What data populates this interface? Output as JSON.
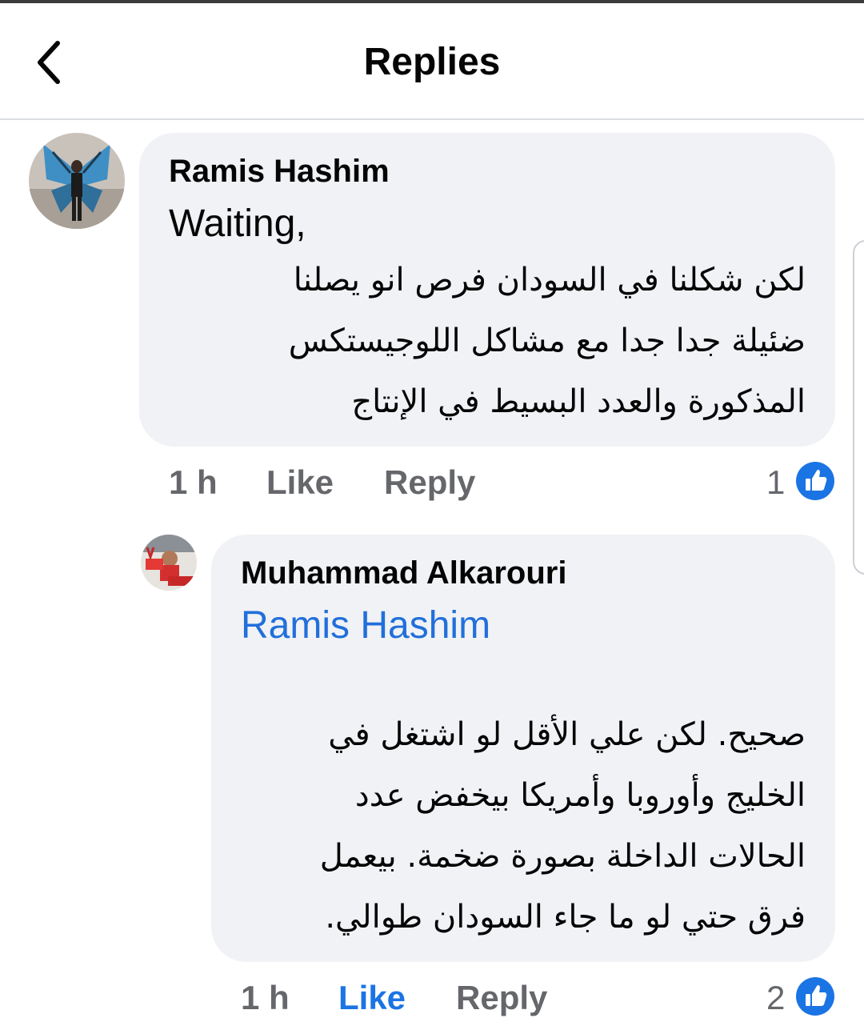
{
  "header": {
    "title": "Replies",
    "back_icon": "chevron-left-icon"
  },
  "comments": [
    {
      "author": "Ramis Hashim",
      "text_en": "Waiting,",
      "text_ar_lines": [
        "لكن شكلنا في السودان فرص انو يصلنا",
        "ضئيلة جدا جدا مع مشاكل اللوجيستكس",
        "المذكورة والعدد البسيط في الإنتاج"
      ],
      "time": "1 h",
      "like_label": "Like",
      "reply_label": "Reply",
      "reaction_count": "1"
    },
    {
      "author": "Muhammad Alkarouri",
      "mention": "Ramis Hashim",
      "text_ar_lines": [
        "صحيح. لكن علي الأقل لو اشتغل في",
        "الخليج وأوروبا وأمريكا بيخفض عدد",
        "الحالات الداخلة بصورة ضخمة. بيعمل",
        "فرق حتي لو ما جاء السودان طوالي."
      ],
      "time": "1 h",
      "like_label": "Like",
      "reply_label": "Reply",
      "reaction_count": "2",
      "liked": true
    }
  ],
  "colors": {
    "bubble": "#f0f2f5",
    "link": "#216fdb",
    "like_active": "#1b74e4",
    "meta": "#65676b"
  }
}
